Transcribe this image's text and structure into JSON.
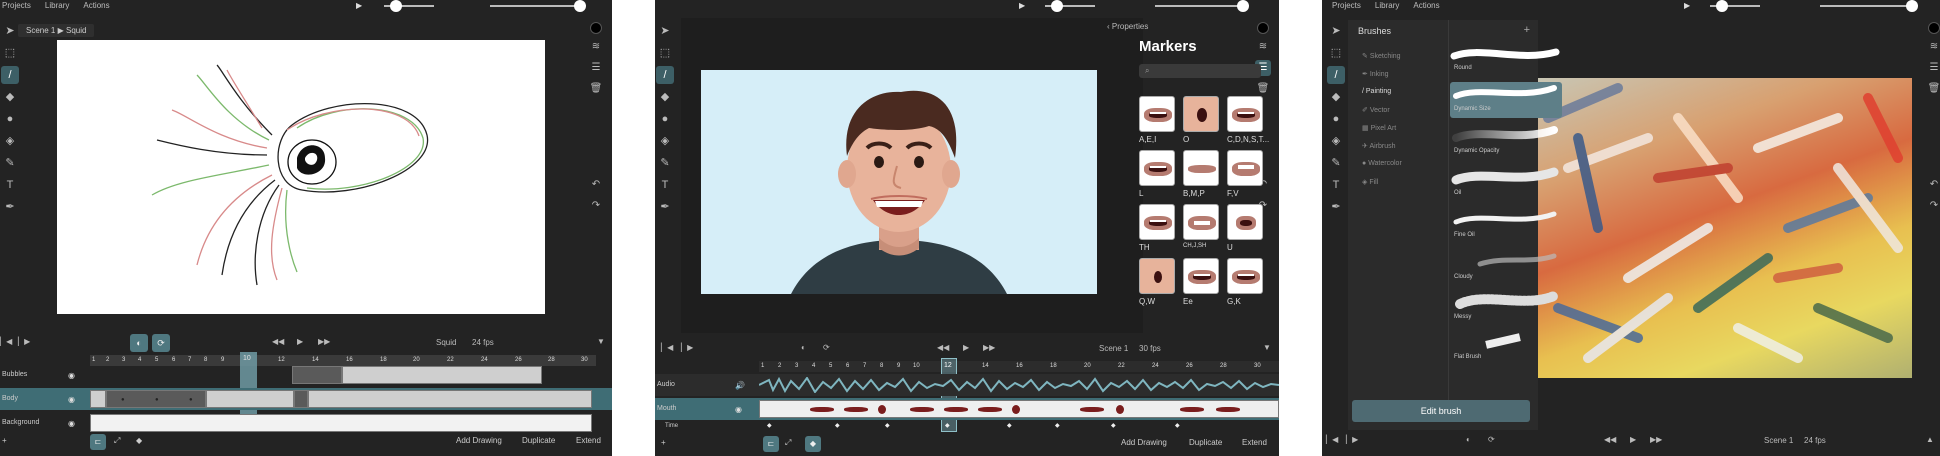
{
  "screens": [
    {
      "menu": [
        "Projects",
        "Library",
        "Actions"
      ],
      "breadcrumb": {
        "scene": "Scene 1",
        "separator": "▶",
        "layer": "Squid"
      },
      "controls": {
        "layer_name": "Squid",
        "fps": "24 fps"
      },
      "ruler_labels": [
        "1",
        "2",
        "3",
        "4",
        "5",
        "6",
        "7",
        "8",
        "9",
        "10",
        "12",
        "14",
        "16",
        "18",
        "20",
        "22",
        "24",
        "26",
        "28",
        "30"
      ],
      "current_frame": "10",
      "tracks": [
        "Bubbles",
        "Body",
        "Background"
      ],
      "bottom_actions": [
        "Add Drawing",
        "Duplicate",
        "Extend"
      ]
    },
    {
      "menu": [
        "Projects",
        "Library",
        "Actions"
      ],
      "properties_back": "Properties",
      "panel_title": "Markers",
      "markers": [
        "A,E,I",
        "O",
        "C,D,N,S,T...",
        "L",
        "B,M,P",
        "F,V",
        "TH",
        "CH,J,SH",
        "U",
        "Q,W",
        "Ee",
        "G,K"
      ],
      "controls": {
        "scene": "Scene 1",
        "fps": "30 fps"
      },
      "ruler_labels": [
        "1",
        "2",
        "3",
        "4",
        "5",
        "6",
        "7",
        "8",
        "9",
        "10",
        "12",
        "14",
        "16",
        "18",
        "20",
        "22",
        "24",
        "26",
        "28",
        "30"
      ],
      "current_frame": "12",
      "tracks": [
        "Audio",
        "Mouth",
        "Time"
      ],
      "bottom_actions": [
        "Add Drawing",
        "Duplicate",
        "Extend"
      ]
    },
    {
      "menu": [
        "Projects",
        "Library",
        "Actions"
      ],
      "brushes_title": "Brushes",
      "add_symbol": "+",
      "categories": [
        "Sketching",
        "Inking",
        "Painting",
        "Vector",
        "Pixel Art",
        "Airbrush",
        "Watercolor",
        "Fill"
      ],
      "active_category": "Painting",
      "brushes": [
        "Round",
        "Dynamic Size",
        "Dynamic Opacity",
        "Oil",
        "Fine Oil",
        "Cloudy",
        "Messy",
        "Flat Brush"
      ],
      "active_brush": "Dynamic Size",
      "edit_brush_label": "Edit brush",
      "controls": {
        "scene": "Scene 1",
        "fps": "24 fps"
      }
    }
  ]
}
